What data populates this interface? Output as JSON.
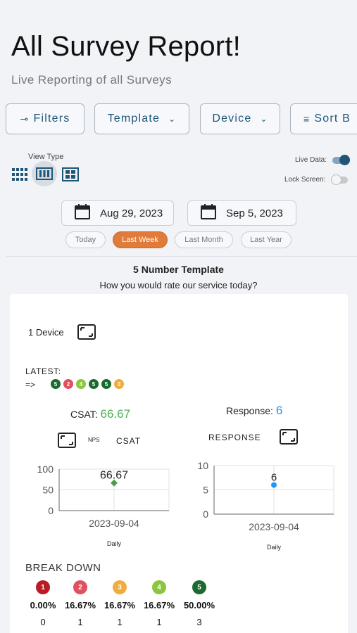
{
  "header": {
    "title": "All Survey Report!",
    "subtitle": "Live Reporting of all Surveys"
  },
  "toolbar": {
    "filters_label": "Filters",
    "template_label": "Template",
    "device_label": "Device",
    "sort_label": "Sort B"
  },
  "view": {
    "view_type_label": "View Type",
    "live_data_label": "Live Data:",
    "live_data_on": true,
    "lock_screen_label": "Lock Screen:",
    "lock_screen_on": false
  },
  "dates": {
    "start": "Aug 29, 2023",
    "end": "Sep 5, 2023"
  },
  "ranges": {
    "today": "Today",
    "last_week": "Last Week",
    "last_month": "Last Month",
    "last_year": "Last Year",
    "selected": "last_week"
  },
  "template": {
    "name": "5 Number Template",
    "question": "How you would rate our service today?"
  },
  "card": {
    "device_count": "1 Device",
    "latest_label": "LATEST:",
    "latest_arrow": "=>",
    "latest_scores": [
      "5",
      "2",
      "4",
      "5",
      "5",
      "3"
    ],
    "csat_label": "CSAT:",
    "csat_value": "66.67",
    "response_label": "Response:",
    "response_value": "6",
    "nps_tab": "NPS",
    "csat_tab": "CSAT",
    "response_tab": "RESPONSE",
    "breakdown_label": "BREAK DOWN",
    "breakdown": [
      {
        "score": "1",
        "pct": "0.00%",
        "count": "0"
      },
      {
        "score": "2",
        "pct": "16.67%",
        "count": "1"
      },
      {
        "score": "3",
        "pct": "16.67%",
        "count": "1"
      },
      {
        "score": "4",
        "pct": "16.67%",
        "count": "1"
      },
      {
        "score": "5",
        "pct": "50.00%",
        "count": "3"
      }
    ]
  },
  "colors": {
    "score_1": "#b71c24",
    "score_2": "#e0505f",
    "score_3": "#f2ac3b",
    "score_4": "#8cc63f",
    "score_5": "#1b6b2f",
    "accent": "#1f5677",
    "active_chip": "#e07b39",
    "csat_green": "#4caf50",
    "response_blue": "#2196f3"
  },
  "chart_data": [
    {
      "type": "scatter",
      "title": "",
      "xlabel": "Daily",
      "ylabel": "",
      "categories": [
        "2023-09-04"
      ],
      "series": [
        {
          "values": [
            66.67
          ],
          "color": "#43a047"
        }
      ],
      "yticks": [
        "0",
        "50",
        "100"
      ],
      "ylim": [
        0,
        100
      ],
      "data_labels": [
        "66.67"
      ],
      "grid": true
    },
    {
      "type": "scatter",
      "title": "",
      "xlabel": "Daily",
      "ylabel": "",
      "categories": [
        "2023-09-04"
      ],
      "series": [
        {
          "values": [
            6
          ],
          "color": "#2196f3"
        }
      ],
      "yticks": [
        "0",
        "5",
        "10"
      ],
      "ylim": [
        0,
        10
      ],
      "data_labels": [
        "6"
      ],
      "grid": true
    }
  ]
}
